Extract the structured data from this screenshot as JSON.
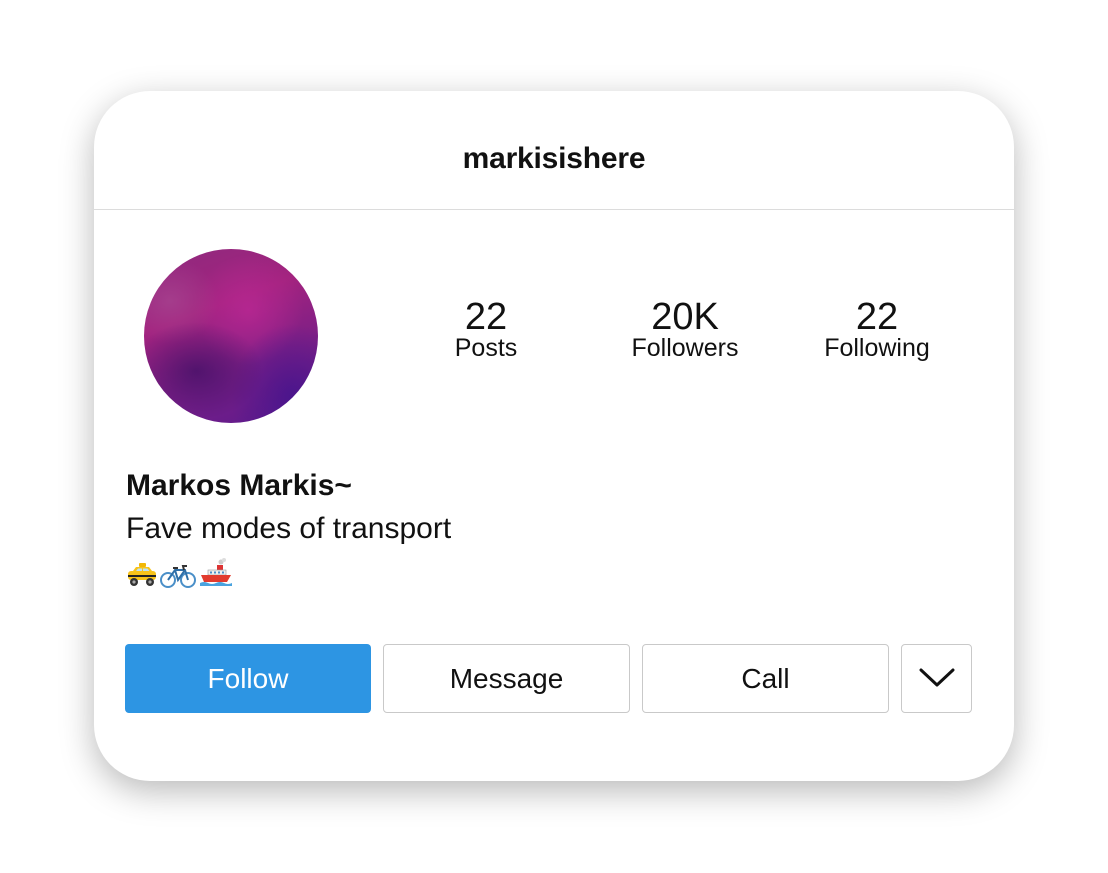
{
  "profile": {
    "username": "markisishere",
    "display_name": "Markos Markis~",
    "bio": "Fave modes of transport",
    "bio_emojis": [
      "taxi-icon",
      "bicycle-icon",
      "ship-icon"
    ],
    "avatar_colors": [
      "#8e2a7e",
      "#a3237f",
      "#5a1a8e"
    ]
  },
  "stats": {
    "posts": {
      "value": "22",
      "label": "Posts"
    },
    "followers": {
      "value": "20K",
      "label": "Followers"
    },
    "following": {
      "value": "22",
      "label": "Following"
    }
  },
  "actions": {
    "follow_label": "Follow",
    "message_label": "Message",
    "call_label": "Call",
    "more_icon": "chevron-down-icon"
  },
  "colors": {
    "accent": "#2d95e3",
    "border": "#c9c9c9",
    "text": "#111111"
  }
}
